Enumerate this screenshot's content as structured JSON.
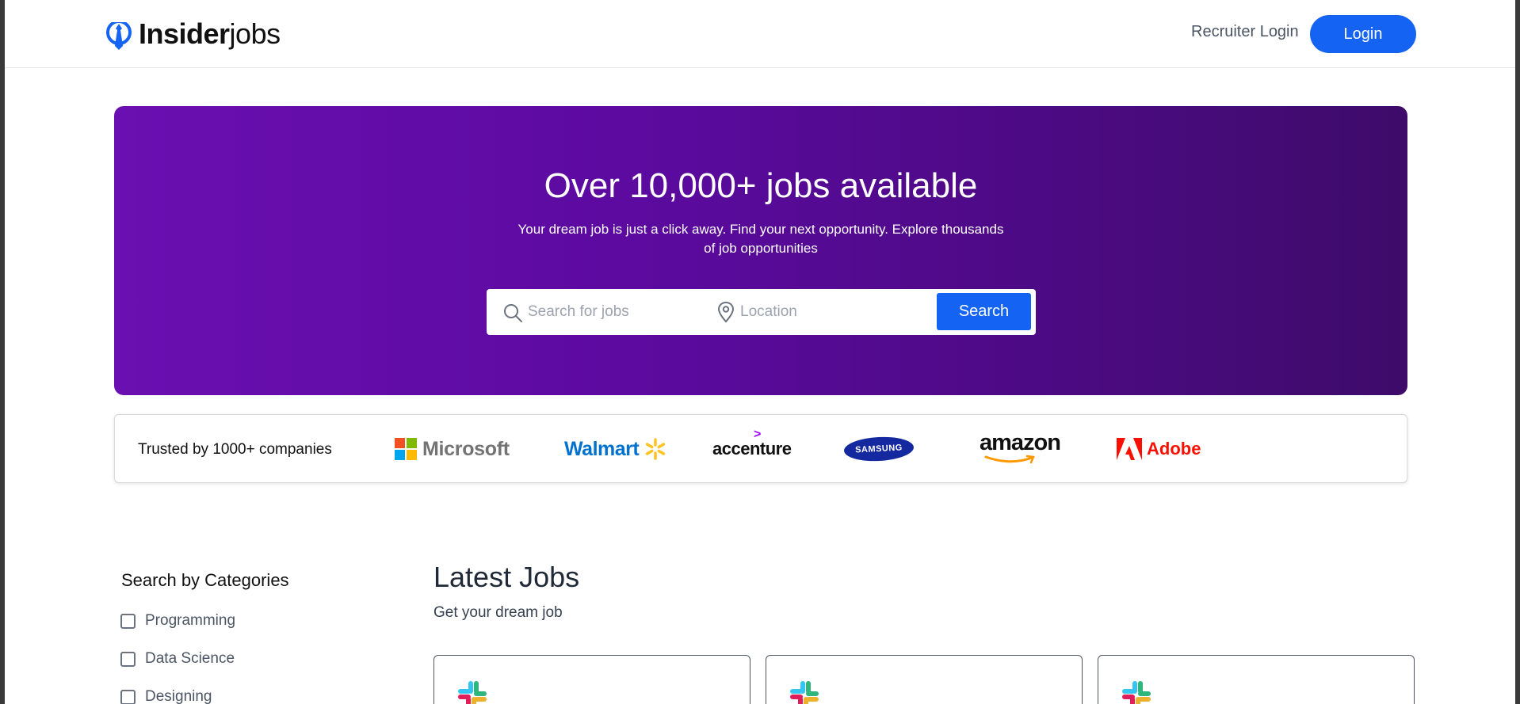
{
  "header": {
    "logo_bold": "Insider",
    "logo_light": "jobs",
    "recruiter_login": "Recruiter Login",
    "login": "Login",
    "accent_color": "#1463f3"
  },
  "hero": {
    "title": "Over 10,000+ jobs available",
    "subtitle": "Your dream job is just a click away. Find your next opportunity. Explore thousands of job opportunities",
    "search_placeholder": "Search for jobs",
    "location_placeholder": "Location",
    "search_button": "Search",
    "gradient_start": "#6a0fb1",
    "gradient_end": "#3e0b6a"
  },
  "trusted": {
    "label": "Trusted by 1000+ companies",
    "companies": [
      "Microsoft",
      "Walmart",
      "accenture",
      "SAMSUNG",
      "amazon",
      "Adobe"
    ]
  },
  "categories": {
    "title": "Search by Categories",
    "items": [
      {
        "label": "Programming",
        "checked": false
      },
      {
        "label": "Data Science",
        "checked": false
      },
      {
        "label": "Designing",
        "checked": false
      }
    ]
  },
  "latest_jobs": {
    "title": "Latest Jobs",
    "subtitle": "Get your dream job",
    "cards": [
      {
        "icon": "slack-icon"
      },
      {
        "icon": "slack-icon"
      },
      {
        "icon": "slack-icon"
      }
    ]
  }
}
